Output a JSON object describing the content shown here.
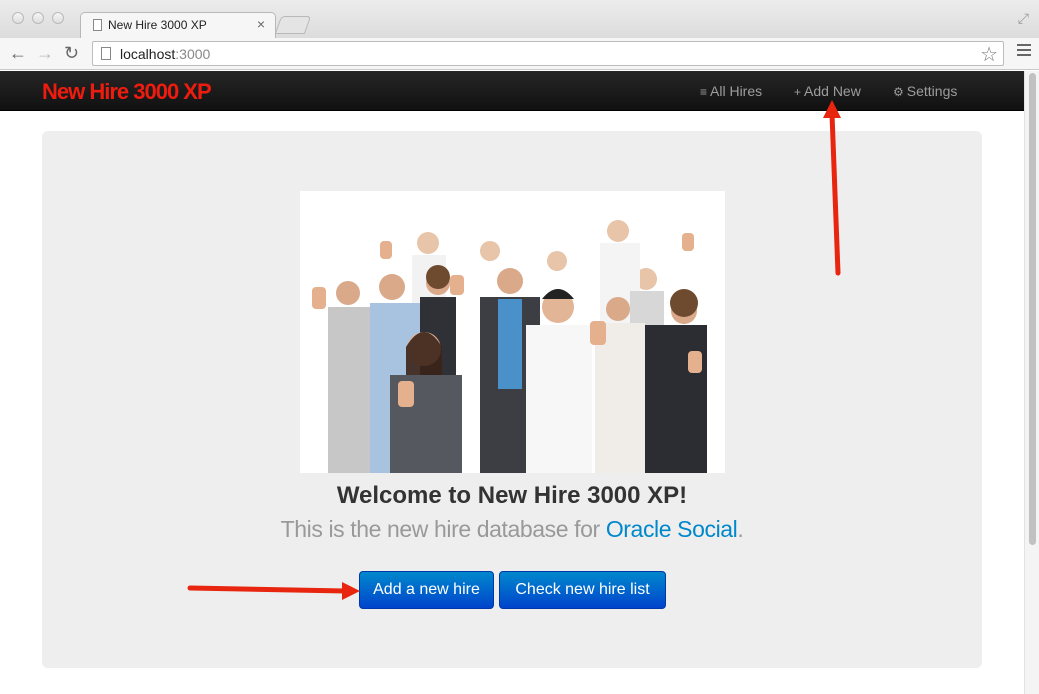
{
  "browser": {
    "tab_title": "New Hire 3000 XP",
    "tab_close": "×",
    "url_host": "localhost",
    "url_port": ":3000"
  },
  "navbar": {
    "brand": "New Hire 3000 XP",
    "links": [
      {
        "icon": "list-icon",
        "glyph": "≡",
        "label": "All Hires"
      },
      {
        "icon": "plus-icon",
        "glyph": "+",
        "label": "Add New"
      },
      {
        "icon": "gear-icon",
        "glyph": "⚙",
        "label": "Settings"
      }
    ]
  },
  "hero": {
    "heading": "Welcome to New Hire 3000 XP!",
    "subtitle_prefix": "This is the new hire database for ",
    "subtitle_link": "Oracle Social",
    "subtitle_suffix": ".",
    "primary_button": "Add a new hire",
    "secondary_button": "Check new hire list"
  },
  "annotations": {
    "arrow_color": "#e8250f"
  },
  "colors": {
    "brand": "#ee1c0e",
    "button": "#0066cc",
    "link": "#0088cc"
  }
}
